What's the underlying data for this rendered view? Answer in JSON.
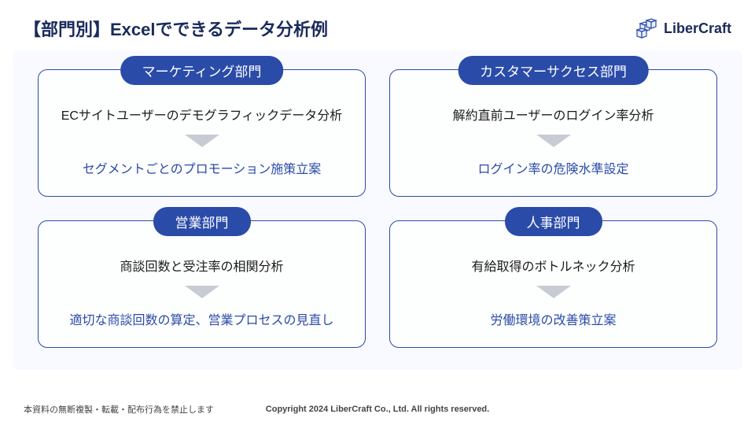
{
  "header": {
    "title": "【部門別】Excelでできるデータ分析例",
    "logo_text": "LiberCraft"
  },
  "cards": [
    {
      "badge": "マーケティング部門",
      "line1": "ECサイトユーザーのデモグラフィックデータ分析",
      "line2": "セグメントごとのプロモーション施策立案"
    },
    {
      "badge": "カスタマーサクセス部門",
      "line1": "解約直前ユーザーのログイン率分析",
      "line2": "ログイン率の危険水準設定"
    },
    {
      "badge": "営業部門",
      "line1": "商談回数と受注率の相関分析",
      "line2": "適切な商談回数の算定、営業プロセスの見直し"
    },
    {
      "badge": "人事部門",
      "line1": "有給取得のボトルネック分析",
      "line2": "労働環境の改善策立案"
    }
  ],
  "footer": {
    "left": "本資料の無断複製・転載・配布行為を禁止します",
    "center": "Copyright 2024 LiberCraft Co., Ltd. All rights reserved."
  }
}
